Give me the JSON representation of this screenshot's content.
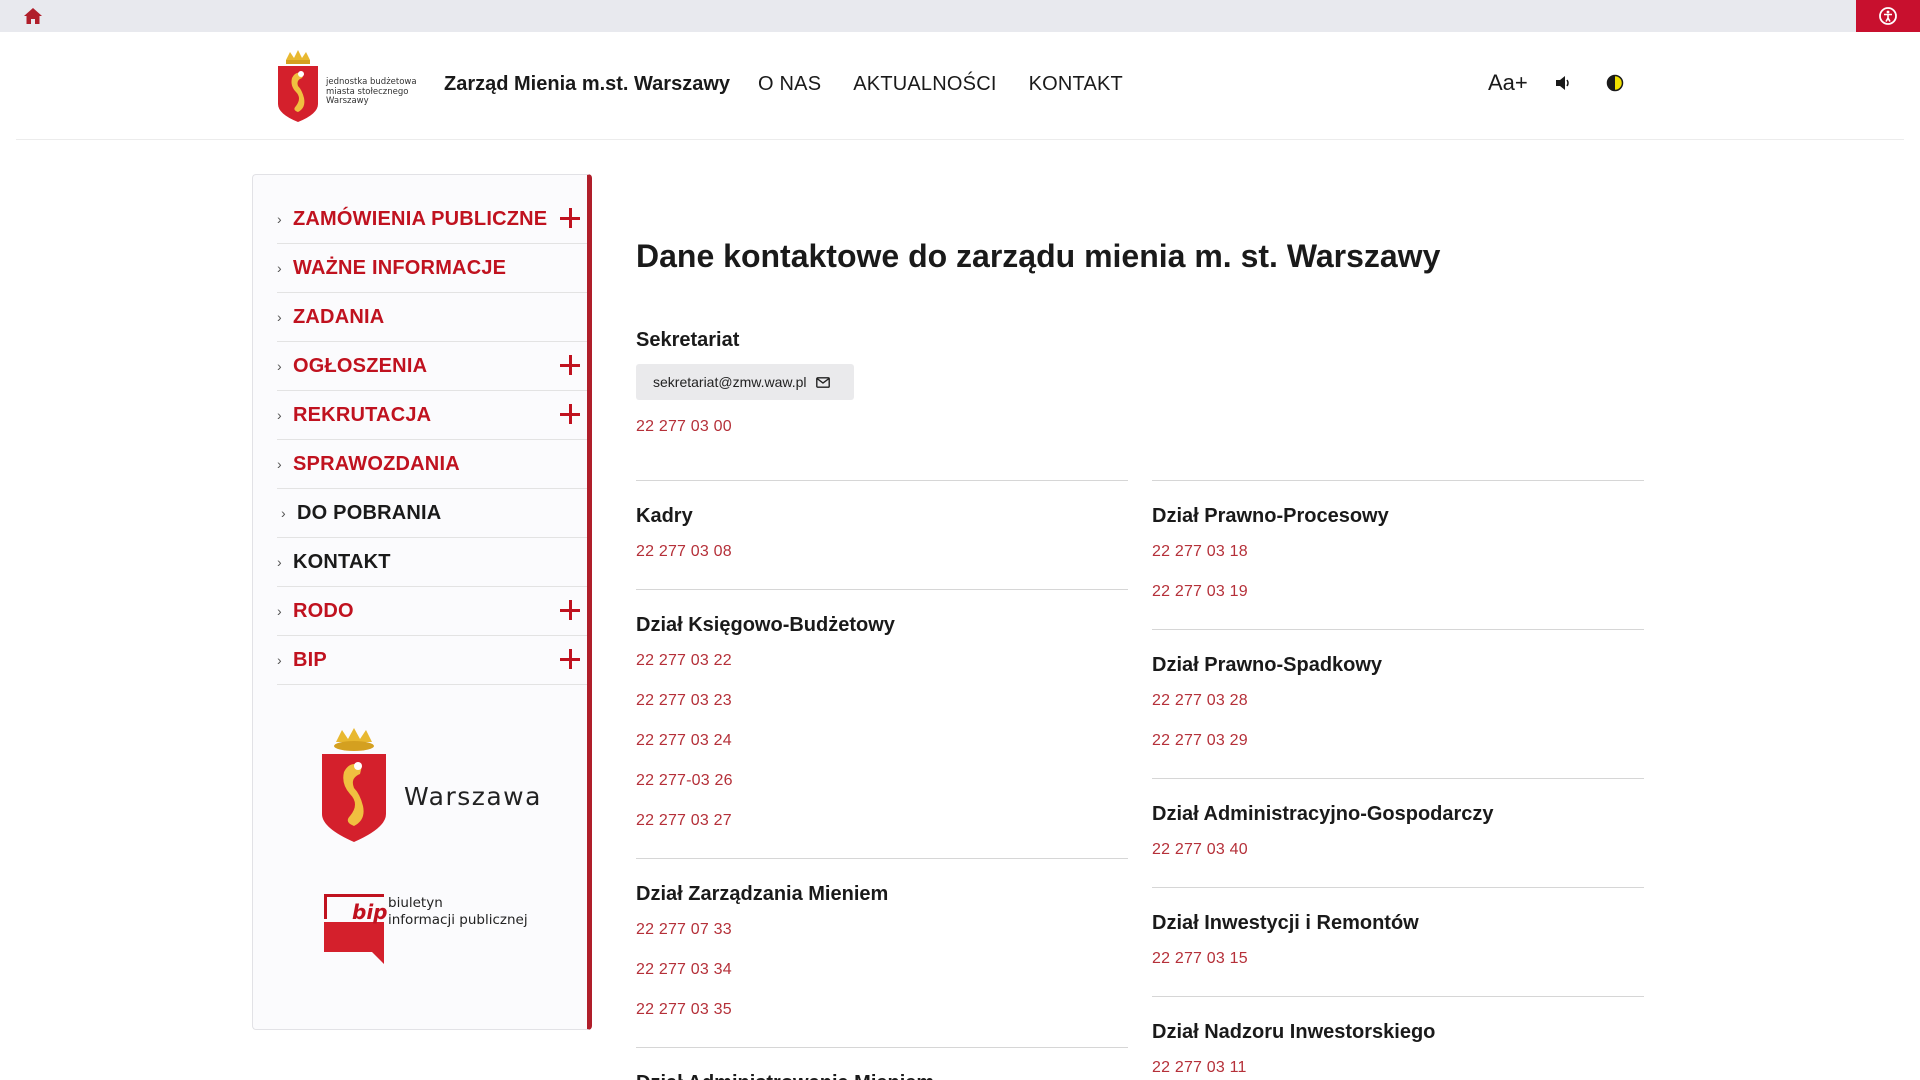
{
  "topbar": {
    "home_icon": "home-icon",
    "accessibility_icon": "accessibility-icon"
  },
  "header": {
    "logo_text": [
      "jednostka budżetowa",
      "miasta stołecznego",
      "Warszawy"
    ],
    "title": "Zarząd Mienia m.st. Warszawy",
    "nav": [
      "O NAS",
      "AKTUALNOŚCI",
      "KONTAKT"
    ],
    "font_tool": "Aa+",
    "sound_icon": "speaker-icon",
    "contrast_icon": "contrast-icon"
  },
  "sidebar": {
    "items": [
      {
        "label": "ZAMÓWIENIA PUBLICZNE",
        "expandable": true,
        "color": "red"
      },
      {
        "label": "WAŻNE INFORMACJE",
        "expandable": false,
        "color": "red"
      },
      {
        "label": "ZADANIA",
        "expandable": false,
        "color": "red"
      },
      {
        "label": "OGŁOSZENIA",
        "expandable": true,
        "color": "red"
      },
      {
        "label": "REKRUTACJA",
        "expandable": true,
        "color": "red"
      },
      {
        "label": "SPRAWOZDANIA",
        "expandable": false,
        "color": "red"
      },
      {
        "label": "DO POBRANIA",
        "expandable": false,
        "color": "dark"
      },
      {
        "label": "KONTAKT",
        "expandable": false,
        "color": "dark"
      },
      {
        "label": "RODO",
        "expandable": true,
        "color": "red"
      },
      {
        "label": "BIP",
        "expandable": true,
        "color": "red"
      }
    ],
    "warszawa_logo_text": "Warszawa",
    "bip_word": "bip",
    "bip_desc": [
      "biuletyn",
      "informacji publicznej"
    ]
  },
  "main": {
    "title": "Dane kontaktowe do zarządu mienia m. st. Warszawy",
    "sekretariat": {
      "name": "Sekretariat",
      "email": "sekretariat@zmw.waw.pl",
      "phones": [
        "22 277 03 00"
      ]
    },
    "left_sections": [
      {
        "name": "Kadry",
        "phones": [
          "22 277 03 08"
        ]
      },
      {
        "name": "Dział Księgowo-Budżetowy",
        "phones": [
          "22 277 03 22",
          "22 277 03 23",
          "22 277 03 24",
          "22 277-03 26",
          "22 277 03 27"
        ]
      },
      {
        "name": "Dział Zarządzania Mieniem",
        "phones": [
          "22 277 07 33",
          "22 277 03 34",
          "22 277 03 35"
        ]
      },
      {
        "name": "Dział Administrowania Mieniem",
        "phones": []
      }
    ],
    "right_sections": [
      {
        "name": "Dział Prawno-Procesowy",
        "phones": [
          "22 277 03 18",
          "22 277 03 19"
        ]
      },
      {
        "name": "Dział Prawno-Spadkowy",
        "phones": [
          "22 277 03 28",
          "22 277 03 29"
        ]
      },
      {
        "name": "Dział Administracyjno-Gospodarczy",
        "phones": [
          "22 277 03 40"
        ]
      },
      {
        "name": "Dział Inwestycji i Remontów",
        "phones": [
          "22 277 03 15"
        ]
      },
      {
        "name": "Dział Nadzoru Inwestorskiego",
        "phones": [
          "22 277 03 11"
        ]
      }
    ]
  },
  "colors": {
    "accent_red": "#c0121f",
    "phone_red": "#b53039",
    "topbar_red": "#c8102e"
  }
}
